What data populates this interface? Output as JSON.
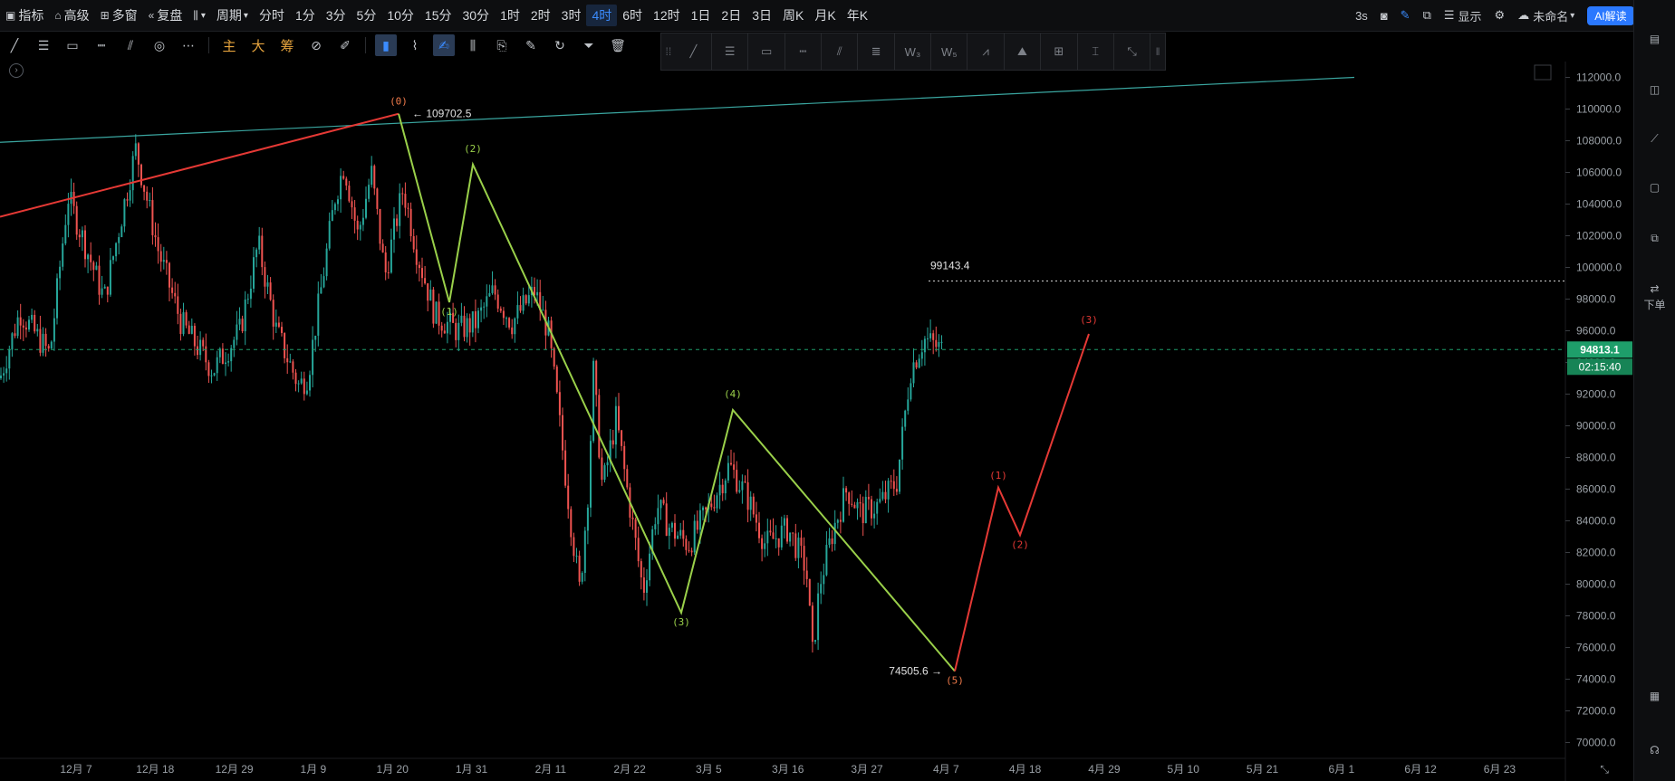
{
  "toolbar": {
    "indicator_label": "指标",
    "advanced_label": "高级",
    "multi_window_label": "多窗",
    "replay_label": "复盘",
    "chart_type_icon": "candles-icon",
    "period_label": "周期",
    "timeframes": [
      "分时",
      "1分",
      "3分",
      "5分",
      "10分",
      "15分",
      "30分",
      "1时",
      "2时",
      "3时",
      "4时",
      "6时",
      "12时",
      "1日",
      "2日",
      "3日",
      "周K",
      "月K",
      "年K"
    ],
    "active_timeframe": "4时",
    "refresh_label": "3s",
    "display_label": "显示",
    "layout_name": "未命名",
    "ai_label": "AI解读"
  },
  "drawing_tools": {
    "main_label": "主",
    "big_label": "大",
    "chip_label": "筹"
  },
  "sidebar": {
    "order_label": "下单"
  },
  "chart_data": {
    "type": "candlestick",
    "symbol_price": "94813.1",
    "countdown": "02:15:40",
    "y_ticks": [
      "112000.0",
      "110000.0",
      "108000.0",
      "106000.0",
      "104000.0",
      "102000.0",
      "100000.0",
      "98000.0",
      "96000.0",
      "94000.0",
      "92000.0",
      "90000.0",
      "88000.0",
      "86000.0",
      "84000.0",
      "82000.0",
      "80000.0",
      "78000.0",
      "76000.0",
      "74000.0",
      "72000.0",
      "70000.0"
    ],
    "ylim": [
      69000,
      113000
    ],
    "x_ticks": [
      "12月 7",
      "12月 18",
      "12月 29",
      "1月 9",
      "1月 20",
      "1月 31",
      "2月 11",
      "2月 22",
      "3月 5",
      "3月 16",
      "3月 27",
      "4月 7",
      "4月 18",
      "4月 29",
      "5月 10",
      "5月 21",
      "6月 1",
      "6月 12",
      "6月 23"
    ],
    "price_close": [
      [
        0,
        93000
      ],
      [
        22,
        97200
      ],
      [
        55,
        94500
      ],
      [
        75,
        104500
      ],
      [
        115,
        98000
      ],
      [
        150,
        107500
      ],
      [
        175,
        101000
      ],
      [
        200,
        96500
      ],
      [
        235,
        93500
      ],
      [
        265,
        96000
      ],
      [
        285,
        101500
      ],
      [
        305,
        96000
      ],
      [
        330,
        92500
      ],
      [
        340,
        93200
      ],
      [
        370,
        104500
      ],
      [
        380,
        106500
      ],
      [
        395,
        102000
      ],
      [
        410,
        106000
      ],
      [
        425,
        99500
      ],
      [
        445,
        105000
      ],
      [
        460,
        101000
      ],
      [
        480,
        97000
      ],
      [
        505,
        96000
      ],
      [
        525,
        96500
      ],
      [
        545,
        98500
      ],
      [
        565,
        96500
      ],
      [
        590,
        98500
      ],
      [
        605,
        96000
      ],
      [
        615,
        91500
      ],
      [
        630,
        84000
      ],
      [
        640,
        79500
      ],
      [
        650,
        86500
      ],
      [
        655,
        93500
      ],
      [
        665,
        86000
      ],
      [
        680,
        90500
      ],
      [
        695,
        85000
      ],
      [
        710,
        79500
      ],
      [
        725,
        85000
      ],
      [
        740,
        83500
      ],
      [
        760,
        82500
      ],
      [
        780,
        84500
      ],
      [
        805,
        87500
      ],
      [
        825,
        85500
      ],
      [
        845,
        82500
      ],
      [
        870,
        83500
      ],
      [
        890,
        81000
      ],
      [
        897,
        75500
      ],
      [
        905,
        80000
      ],
      [
        920,
        83500
      ],
      [
        935,
        86000
      ],
      [
        950,
        84500
      ],
      [
        970,
        85000
      ],
      [
        990,
        86500
      ],
      [
        1005,
        93500
      ],
      [
        1020,
        95500
      ],
      [
        1040,
        94800
      ]
    ],
    "price_high_marker": {
      "label": "(0)",
      "value": "109702.5"
    },
    "price_low_marker": {
      "label": "(5)",
      "value": "74505.6"
    },
    "horizontal_level": {
      "value": "99143.4"
    },
    "wave_green": [
      {
        "label": "(0)",
        "value": 109702.5,
        "x_date_idx": 370
      },
      {
        "label": "(1)",
        "value": 97800,
        "x_date_idx": 420
      },
      {
        "label": "(2)",
        "value": 106500,
        "x_date_idx": 443
      },
      {
        "label": "(3)",
        "value": 78200,
        "x_date_idx": 638
      },
      {
        "label": "(4)",
        "value": 91000,
        "x_date_idx": 686
      },
      {
        "label": "(5)",
        "value": 74505.6,
        "x_date_idx": 893
      }
    ],
    "wave_red_up": [
      {
        "label": "(5)",
        "value": 74505.6
      },
      {
        "label": "(1)",
        "value": 86100
      },
      {
        "label": "(2)",
        "value": 83100
      },
      {
        "label": "(3)",
        "value": 95800
      }
    ],
    "colors": {
      "up": "#26a69a",
      "down": "#ef5350",
      "green_wave": "#9ad04a",
      "red_wave": "#e53935",
      "trendline": "#3aa6a0",
      "price_tag": "#1e9e6a"
    }
  }
}
